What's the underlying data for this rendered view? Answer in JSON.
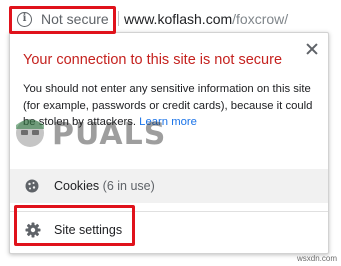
{
  "omnibox": {
    "security_label": "Not secure",
    "url_host": "www.koflash.com",
    "url_path": "/foxcrow/"
  },
  "popup": {
    "title": "Your connection to this site is not secure",
    "description": "You should not enter any sensitive information on this site (for example, passwords or credit cards), because it could be stolen by attackers.",
    "learn_more": "Learn more",
    "cookies": {
      "label": "Cookies",
      "count": "(6 in use)"
    },
    "site_settings": {
      "label": "Site settings"
    }
  },
  "watermark": {
    "text": "PUALS"
  },
  "site_credit": "wsxdn.com",
  "colors": {
    "warning_red": "#c5221f",
    "highlight_red": "#e0121b",
    "link_blue": "#1a73e8"
  },
  "icons": {
    "security": "info-icon",
    "close": "close-icon",
    "cookies": "cookie-icon",
    "settings": "gear-icon"
  }
}
